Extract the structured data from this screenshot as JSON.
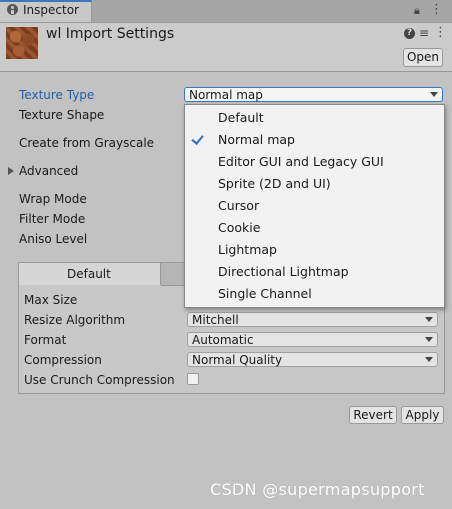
{
  "window": {
    "tab_label": "Inspector",
    "lock_icon": "lock-icon",
    "menu_icon": "more-menu-icon"
  },
  "header": {
    "title": "wl Import Settings",
    "open_label": "Open",
    "help_icon": "help-icon",
    "settings_icon": "sliders-icon",
    "more_icon": "more-vertical-icon"
  },
  "fields": {
    "texture_type_label": "Texture Type",
    "texture_type_value": "Normal map",
    "texture_shape_label": "Texture Shape",
    "create_from_grayscale_label": "Create from Grayscale",
    "advanced_label": "Advanced",
    "wrap_mode_label": "Wrap Mode",
    "filter_mode_label": "Filter Mode",
    "aniso_level_label": "Aniso Level"
  },
  "platform": {
    "tab_default": "Default",
    "max_size_label": "Max Size",
    "resize_algorithm_label": "Resize Algorithm",
    "resize_algorithm_value": "Mitchell",
    "format_label": "Format",
    "format_value": "Automatic",
    "compression_label": "Compression",
    "compression_value": "Normal Quality",
    "crunch_label": "Use Crunch Compression",
    "crunch_checked": false
  },
  "buttons": {
    "revert": "Revert",
    "apply": "Apply"
  },
  "popup": {
    "selected": "Normal map",
    "options": [
      "Default",
      "Normal map",
      "Editor GUI and Legacy GUI",
      "Sprite (2D and UI)",
      "Cursor",
      "Cookie",
      "Lightmap",
      "Directional Lightmap",
      "Single Channel"
    ]
  },
  "watermark": "CSDN @supermapsupport",
  "colors": {
    "accent": "#3a79bb",
    "label_active": "#1f5ea8",
    "panel_bg": "#c2c2c2"
  }
}
